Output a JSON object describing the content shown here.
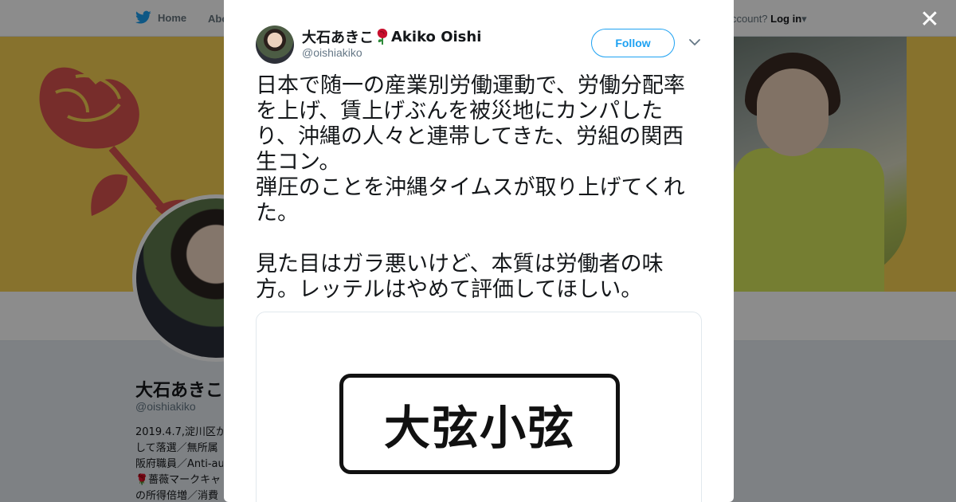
{
  "background": {
    "nav": {
      "home_label": "Home",
      "about_label": "Abo",
      "login_prompt": "ccount?",
      "login_label": "Log in"
    },
    "profile": {
      "name": "大石あきこ",
      "handle": "@oishiakiko",
      "bio_lines": [
        "2019.4.7,淀川区か",
        "して落選／無所属",
        "阪府職員／Anti-au",
        "🌹薔薇マークキャ",
        "の所得倍増／消費"
      ]
    }
  },
  "tweet": {
    "author_name": "大石あきこ",
    "author_name_latin": "Akiko Oishi",
    "author_handle": "@oishiakiko",
    "follow_label": "Follow",
    "text": "日本で随一の産業別労働運動で、労働分配率を上げ、賃上げぶんを被災地にカンパしたり、沖縄の人々と連帯してきた、労組の関西生コン。\n弾圧のことを沖縄タイムスが取り上げてくれた。\n\n見た目はガラ悪いけど、本質は労働者の味方。レッテルはやめて評価してほしい。",
    "media_text": "大弦小弦"
  },
  "colors": {
    "accent": "#1da1f2",
    "banner_yellow": "#f6cf52",
    "rose_red": "#d9534f"
  },
  "icons": [
    "twitter-bird-icon",
    "rose-icon",
    "chevron-down-icon",
    "close-icon"
  ]
}
